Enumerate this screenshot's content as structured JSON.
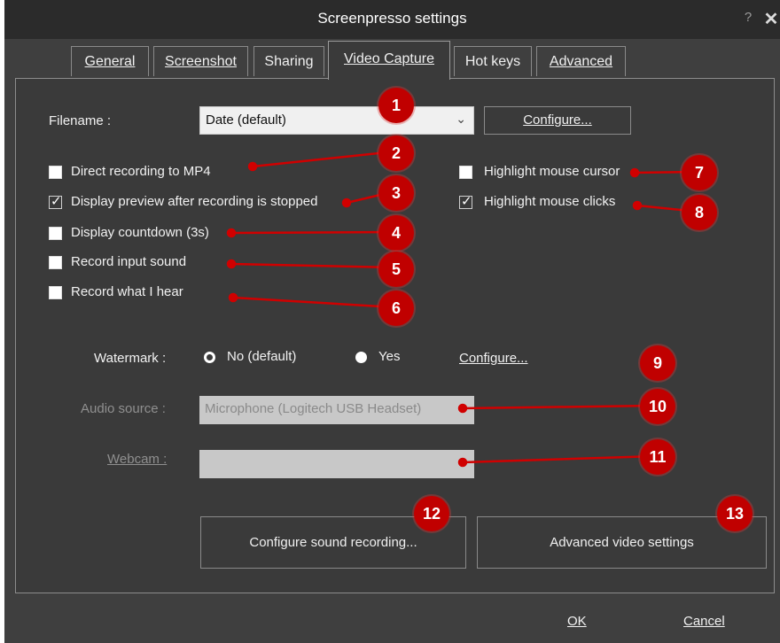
{
  "window": {
    "title": "Screenpresso settings",
    "help": "?",
    "close": "✕"
  },
  "tabs": [
    {
      "label": "General"
    },
    {
      "label": "Screenshot"
    },
    {
      "label": "Sharing"
    },
    {
      "label": "Video Capture"
    },
    {
      "label": "Hot keys"
    },
    {
      "label": "Advanced"
    }
  ],
  "filename": {
    "label": "Filename :",
    "value": "Date (default)",
    "configure_label": "Configure..."
  },
  "options_left": [
    {
      "label": "Direct recording to MP4",
      "checked": false
    },
    {
      "label": "Display preview after recording is stopped",
      "checked": true
    },
    {
      "label": "Display countdown (3s)",
      "checked": false
    },
    {
      "label": "Record input sound",
      "checked": false
    },
    {
      "label": "Record what I hear",
      "checked": false
    }
  ],
  "options_right": [
    {
      "label": "Highlight mouse cursor",
      "checked": false
    },
    {
      "label": "Highlight mouse clicks",
      "checked": true
    }
  ],
  "watermark": {
    "label": "Watermark :",
    "option_no": "No (default)",
    "option_yes": "Yes",
    "selected": "No (default)",
    "configure_label": "Configure..."
  },
  "audio_source": {
    "label": "Audio source :",
    "value": "Microphone (Logitech USB Headset)"
  },
  "webcam": {
    "label": "Webcam :",
    "value": ""
  },
  "buttons": {
    "configure_sound": "Configure sound recording...",
    "advanced_video": "Advanced video settings",
    "ok": "OK",
    "cancel": "Cancel"
  },
  "callouts": [
    "1",
    "2",
    "3",
    "4",
    "5",
    "6",
    "7",
    "8",
    "9",
    "10",
    "11",
    "12",
    "13"
  ],
  "colors": {
    "window_bg": "#3f3f3f",
    "titlebar_bg": "#2b2b2b",
    "callout_red": "#c00000"
  }
}
